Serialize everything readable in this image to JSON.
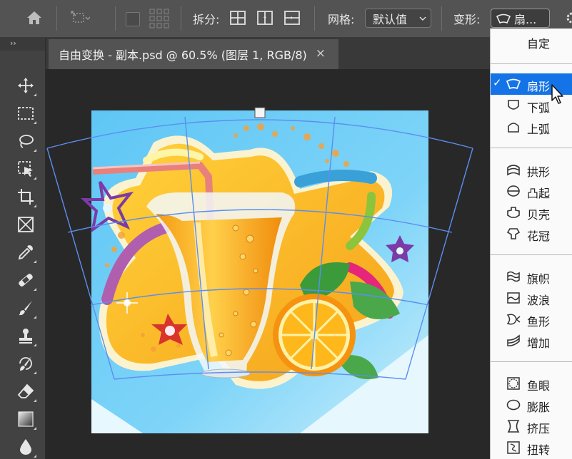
{
  "options_bar": {
    "split_label": "拆分:",
    "grid_label": "网格:",
    "grid_value": "默认值",
    "warp_label": "变形:",
    "warp_value": "扇..."
  },
  "document": {
    "tab_title": "自由变换 - 副本.psd @ 60.5% (图层 1, RGB/8)",
    "close_glyph": "×"
  },
  "toolbar": {
    "collapse_glyph": "››",
    "tools": [
      "move-tool",
      "marquee-tool",
      "lasso-tool",
      "object-select-tool",
      "crop-tool",
      "frame-tool",
      "eyedropper-tool",
      "healing-brush-tool",
      "brush-tool",
      "clone-stamp-tool",
      "history-brush-tool",
      "eraser-tool",
      "gradient-tool",
      "blur-tool"
    ]
  },
  "warp_menu": {
    "custom": "自定",
    "groups": [
      [
        {
          "label": "扇形",
          "icon": "arc-icon",
          "selected": true
        },
        {
          "label": "下弧",
          "icon": "arc-lower-icon"
        },
        {
          "label": "上弧",
          "icon": "arc-upper-icon"
        }
      ],
      [
        {
          "label": "拱形",
          "icon": "arch-icon"
        },
        {
          "label": "凸起",
          "icon": "bulge-icon"
        },
        {
          "label": "贝壳",
          "icon": "shell-lower-icon"
        },
        {
          "label": "花冠",
          "icon": "shell-upper-icon"
        }
      ],
      [
        {
          "label": "旗帜",
          "icon": "flag-icon"
        },
        {
          "label": "波浪",
          "icon": "wave-icon"
        },
        {
          "label": "鱼形",
          "icon": "fish-icon"
        },
        {
          "label": "增加",
          "icon": "rise-icon"
        }
      ],
      [
        {
          "label": "鱼眼",
          "icon": "fisheye-icon"
        },
        {
          "label": "膨胀",
          "icon": "inflate-icon"
        },
        {
          "label": "挤压",
          "icon": "squeeze-icon"
        },
        {
          "label": "扭转",
          "icon": "twist-icon"
        }
      ]
    ],
    "checkmark": "✓"
  },
  "colors": {
    "accent": "#1473e6",
    "warp_grid": "#5b8ef0",
    "panel": "#535353"
  }
}
